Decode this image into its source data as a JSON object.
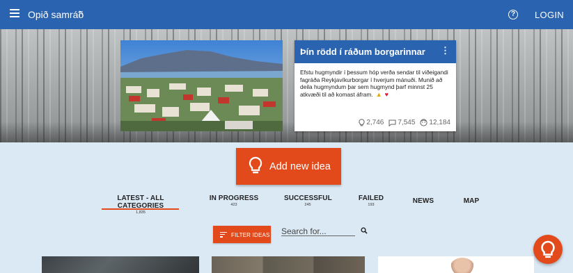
{
  "appbar": {
    "title": "Opið samráð",
    "login_label": "LOGIN",
    "icons": {
      "menu": "menu-icon",
      "up": "arrow-up-icon",
      "help": "help-icon"
    }
  },
  "featured_card": {
    "title": "Þín rödd í ráðum borgarinnar",
    "description": "Efstu hugmyndir í þessum hóp verða sendar til viðeigandi fagráða Reykjavíkurborgar í hverjum mánuði. Munið að deila hugmyndum þar sem hugmynd þarf minnst 25 atkvæði til að komast áfram.",
    "stats": {
      "ideas": "2,746",
      "comments": "7,545",
      "users": "12,184"
    }
  },
  "add_idea": {
    "label": "Add new idea"
  },
  "tabs": [
    {
      "label": "LATEST - ALL CATEGORIES",
      "count": "1,835"
    },
    {
      "label": "IN PROGRESS",
      "count": "423"
    },
    {
      "label": "SUCCESSFUL",
      "count": "245"
    },
    {
      "label": "FAILED",
      "count": "193"
    },
    {
      "label": "NEWS",
      "count": ""
    },
    {
      "label": "MAP",
      "count": ""
    }
  ],
  "filter": {
    "label": "FILTER IDEAS"
  },
  "search": {
    "placeholder": "Search for..."
  },
  "colors": {
    "primary": "#2a63b0",
    "accent": "#e24a1b",
    "background": "#dbe9f5"
  }
}
